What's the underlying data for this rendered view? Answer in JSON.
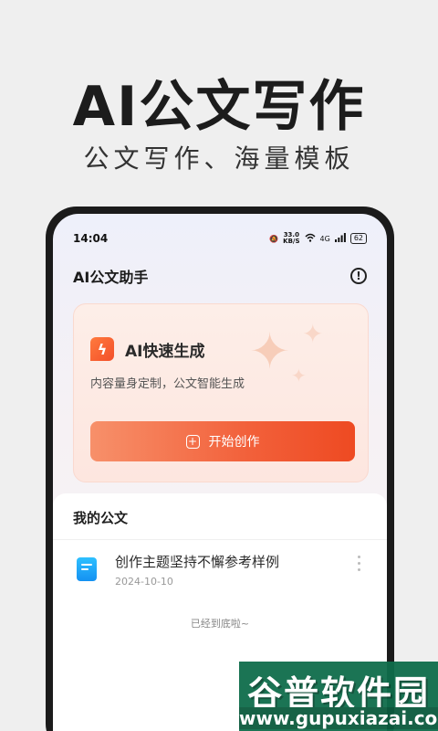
{
  "hero": {
    "title": "AI公文写作",
    "subtitle": "公文写作、海量模板"
  },
  "status_bar": {
    "time": "14:04",
    "net_speed_value": "33.0",
    "net_speed_unit": "KB/S",
    "signal": "4G",
    "battery": "62"
  },
  "app_bar": {
    "title": "AI公文助手",
    "info_icon": "info-circle-icon"
  },
  "generate_card": {
    "title": "AI快速生成",
    "description": "内容量身定制，公文智能生成",
    "button_label": "开始创作",
    "icon": "lightning-icon",
    "accent_color": "#f2603a"
  },
  "documents": {
    "section_title": "我的公文",
    "items": [
      {
        "name": "创作主题坚持不懈参考样例",
        "date": "2024-10-10"
      }
    ],
    "end_text": "已经到底啦~"
  },
  "watermark": {
    "top": "谷普软件园",
    "bottom": "www.gupuxiazai.com"
  }
}
